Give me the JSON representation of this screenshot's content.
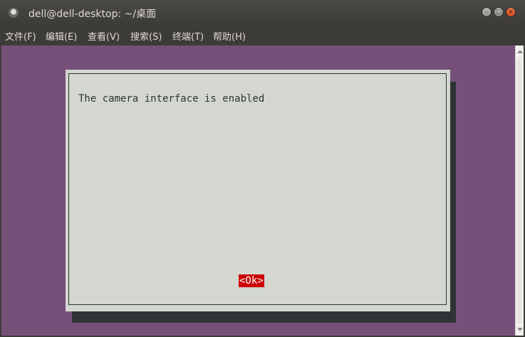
{
  "window": {
    "title": "dell@dell-desktop: ~/桌面",
    "icon": "terminal-icon",
    "buttons": {
      "minimize": "minimize-icon",
      "maximize": "maximize-icon",
      "close": "close-icon"
    }
  },
  "menubar": {
    "items": [
      {
        "label": "文件(F)"
      },
      {
        "label": "编辑(E)"
      },
      {
        "label": "查看(V)"
      },
      {
        "label": "搜索(S)"
      },
      {
        "label": "终端(T)"
      },
      {
        "label": "帮助(H)"
      }
    ]
  },
  "dialog": {
    "message": "The camera interface is enabled",
    "ok_label": "<Ok>"
  },
  "colors": {
    "terminal_background": "#77507a",
    "dialog_background": "#d3d7cf",
    "dialog_shadow": "#2e3436",
    "ok_highlight": "#cc0000"
  }
}
